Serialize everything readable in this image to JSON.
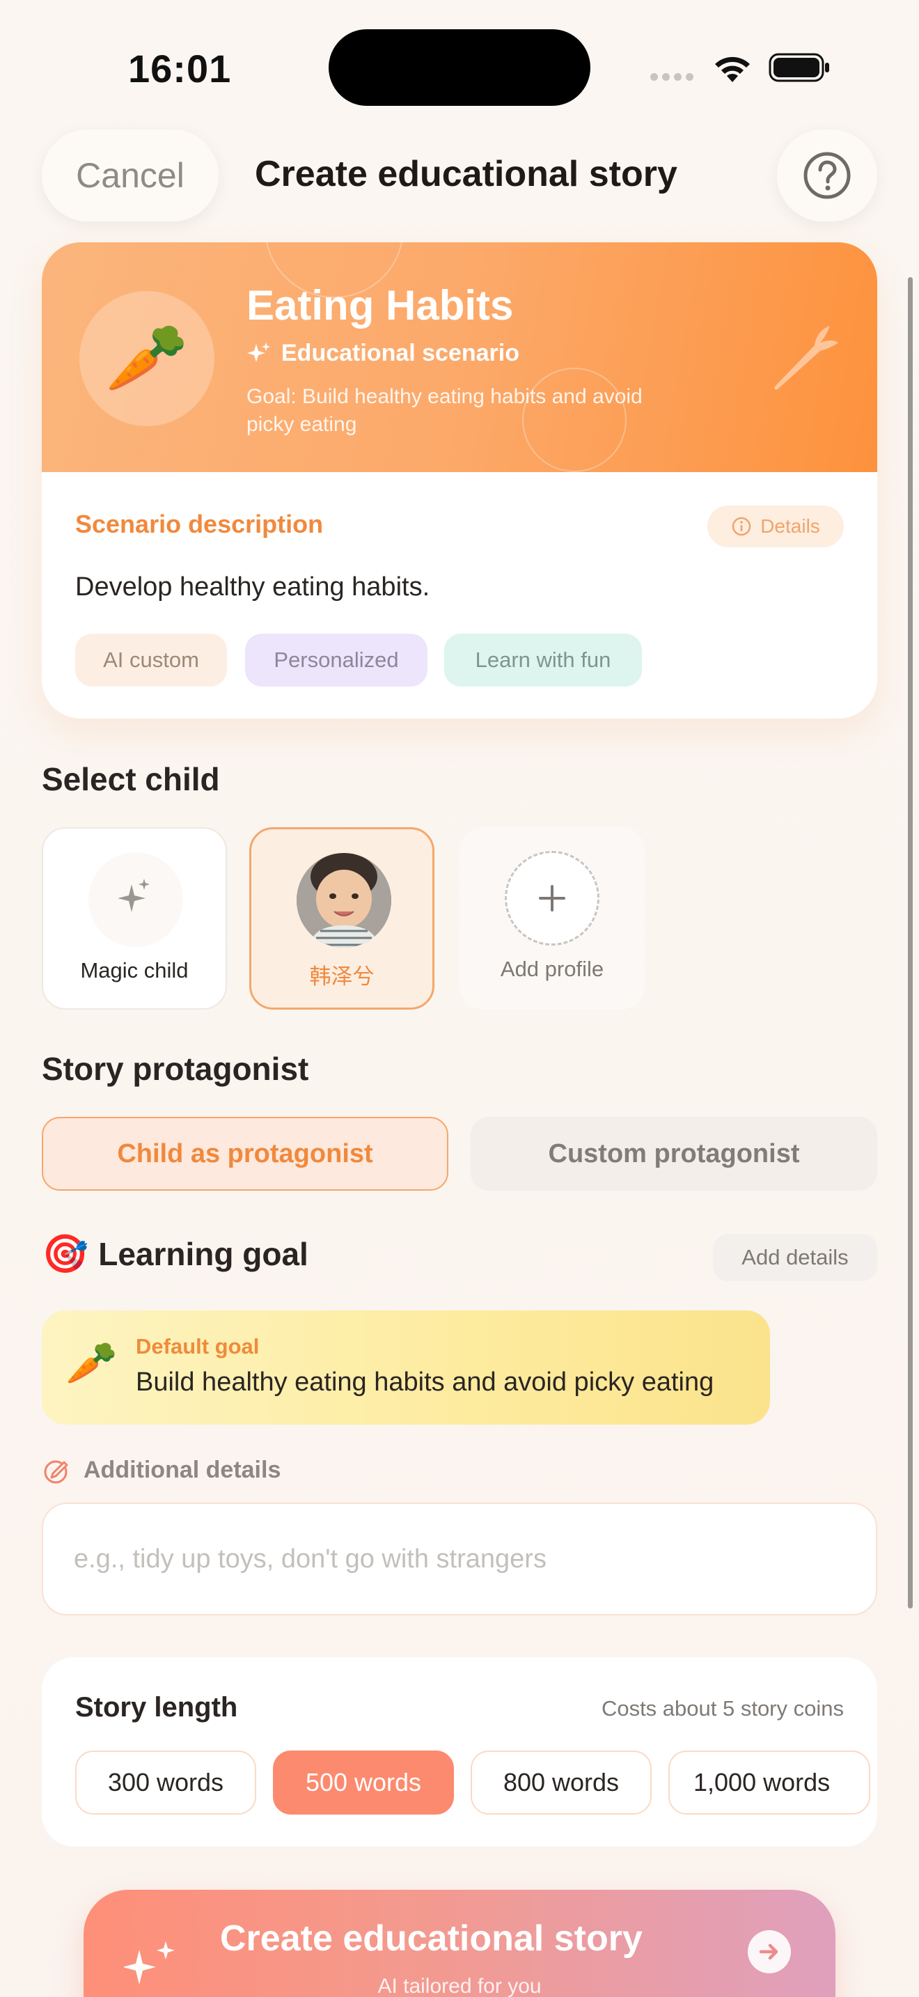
{
  "status_bar": {
    "time": "16:01"
  },
  "header": {
    "cancel_label": "Cancel",
    "title": "Create educational story",
    "help_icon": "question-circle-icon"
  },
  "scenario": {
    "emoji": "🥕",
    "title": "Eating Habits",
    "subtitle": "Educational scenario",
    "goal": "Goal: Build healthy eating habits and avoid picky eating",
    "description_label": "Scenario description",
    "details_label": "Details",
    "description": "Develop healthy eating habits.",
    "tags": [
      {
        "label": "AI custom",
        "bg": "#fdeee3",
        "color": "#9b8878"
      },
      {
        "label": "Personalized",
        "bg": "#ece5fb",
        "color": "#8e8798"
      },
      {
        "label": "Learn with fun",
        "bg": "#ddf5ee",
        "color": "#7e958e"
      }
    ]
  },
  "select_child": {
    "title": "Select child",
    "cards": [
      {
        "label": "Magic child"
      },
      {
        "label": "韩泽兮"
      },
      {
        "label": "Add profile"
      }
    ]
  },
  "protagonist": {
    "title": "Story protagonist",
    "options": [
      {
        "label": "Child as protagonist",
        "selected": true
      },
      {
        "label": "Custom protagonist",
        "selected": false
      }
    ]
  },
  "learning_goal": {
    "emoji": "🎯",
    "title": "Learning goal",
    "add_details_label": "Add details",
    "default_goal_label": "Default goal",
    "default_goal_text": "Build healthy eating habits and avoid picky eating",
    "additional_label": "Additional details",
    "additional_placeholder": "e.g., tidy up toys, don't go with strangers"
  },
  "story_length": {
    "title": "Story length",
    "cost": "Costs about 5 story coins",
    "options": [
      "300 words",
      "500 words",
      "800 words",
      "1,000 words"
    ],
    "selected": "500 words"
  },
  "cta": {
    "title": "Create educational story",
    "subtitle": "AI tailored for you"
  },
  "colors": {
    "accent": "#f0893d",
    "cta_start": "#fe8f78",
    "cta_end": "#dfa0bd"
  }
}
